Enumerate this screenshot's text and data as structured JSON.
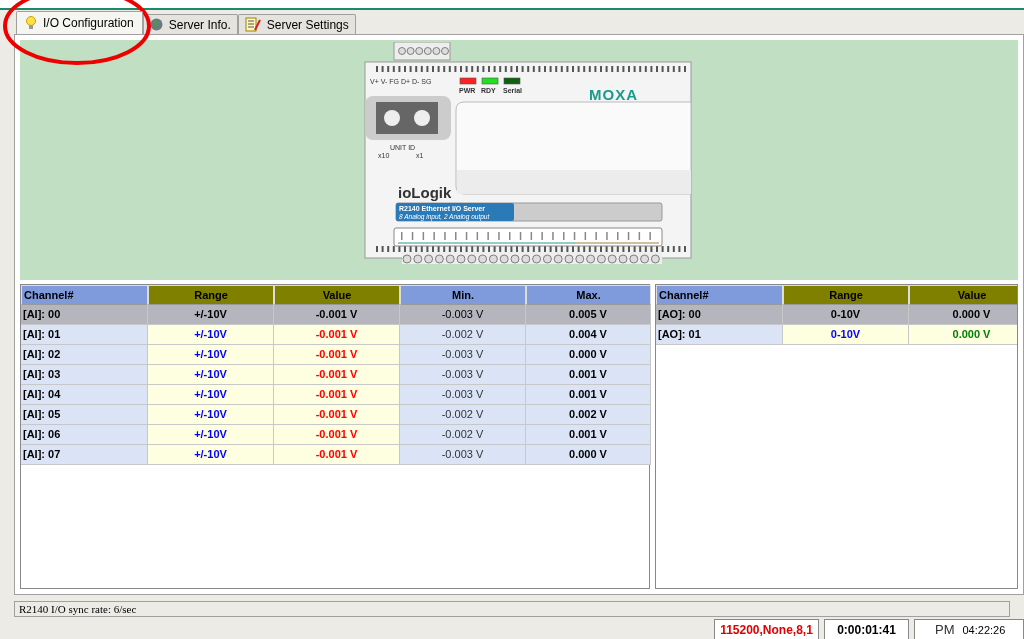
{
  "tabs": [
    {
      "label": "I/O Configuration",
      "selected": true
    },
    {
      "label": "Server Info.",
      "selected": false
    },
    {
      "label": "Server Settings",
      "selected": false
    }
  ],
  "device": {
    "brand": "MOXA",
    "model_logo": "ioLogik",
    "power_labels": "V+  V-  FG  D+  D-  SG",
    "leds": [
      {
        "label": "PWR",
        "color": "#ff2020"
      },
      {
        "label": "RDY",
        "color": "#20e020"
      },
      {
        "label": "Serial",
        "color": "#106010"
      }
    ],
    "unit_id": "UNIT ID",
    "switch_labels": [
      "x10",
      "x1"
    ],
    "banner_title": "R2140 Ethernet I/O Server",
    "banner_subtitle": "8 Analog input, 2 Analog output"
  },
  "tables": [
    {
      "kind": "input",
      "columns": [
        "Channel#",
        "Range",
        "Value",
        "Min.",
        "Max."
      ],
      "rows": [
        {
          "cells": [
            "[AI]: 00",
            "+/-10V",
            "-0.001 V",
            "-0.003 V",
            "0.005 V"
          ],
          "selected": true
        },
        {
          "cells": [
            "[AI]: 01",
            "+/-10V",
            "-0.001 V",
            "-0.002 V",
            "0.004 V"
          ],
          "selected": false
        },
        {
          "cells": [
            "[AI]: 02",
            "+/-10V",
            "-0.001 V",
            "-0.003 V",
            "0.000 V"
          ],
          "selected": false
        },
        {
          "cells": [
            "[AI]: 03",
            "+/-10V",
            "-0.001 V",
            "-0.003 V",
            "0.001 V"
          ],
          "selected": false
        },
        {
          "cells": [
            "[AI]: 04",
            "+/-10V",
            "-0.001 V",
            "-0.003 V",
            "0.001 V"
          ],
          "selected": false
        },
        {
          "cells": [
            "[AI]: 05",
            "+/-10V",
            "-0.001 V",
            "-0.002 V",
            "0.002 V"
          ],
          "selected": false
        },
        {
          "cells": [
            "[AI]: 06",
            "+/-10V",
            "-0.001 V",
            "-0.002 V",
            "0.001 V"
          ],
          "selected": false
        },
        {
          "cells": [
            "[AI]: 07",
            "+/-10V",
            "-0.001 V",
            "-0.003 V",
            "0.000 V"
          ],
          "selected": false
        }
      ]
    },
    {
      "kind": "output",
      "columns": [
        "Channel#",
        "Range",
        "Value"
      ],
      "rows": [
        {
          "cells": [
            "[AO]: 00",
            "0-10V",
            "0.000 V"
          ],
          "selected": true
        },
        {
          "cells": [
            "[AO]: 01",
            "0-10V",
            "0.000 V"
          ],
          "selected": false
        }
      ]
    }
  ],
  "status_line": "R2140 I/O sync rate: 6/sec",
  "status_bar": {
    "serial": "115200,None,8,1",
    "elapsed": "0:00:01:41",
    "ampm": "PM",
    "clock": "04:22:26"
  }
}
